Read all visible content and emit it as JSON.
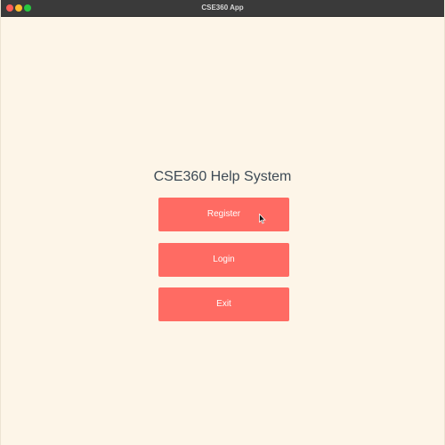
{
  "window": {
    "title": "CSE360 App",
    "traffic_lights": {
      "close_color": "#ff5f57",
      "minimize_color": "#febc2e",
      "maximize_color": "#28c840"
    }
  },
  "main": {
    "heading": "CSE360 Help System",
    "buttons": {
      "register": "Register",
      "login": "Login",
      "exit": "Exit"
    }
  },
  "colors": {
    "background": "#fdf5e8",
    "button": "#ff6b63",
    "button_text": "#ffffff",
    "heading_text": "#3d4a55"
  },
  "icons": {
    "cursor": "mouse-pointer-icon"
  }
}
